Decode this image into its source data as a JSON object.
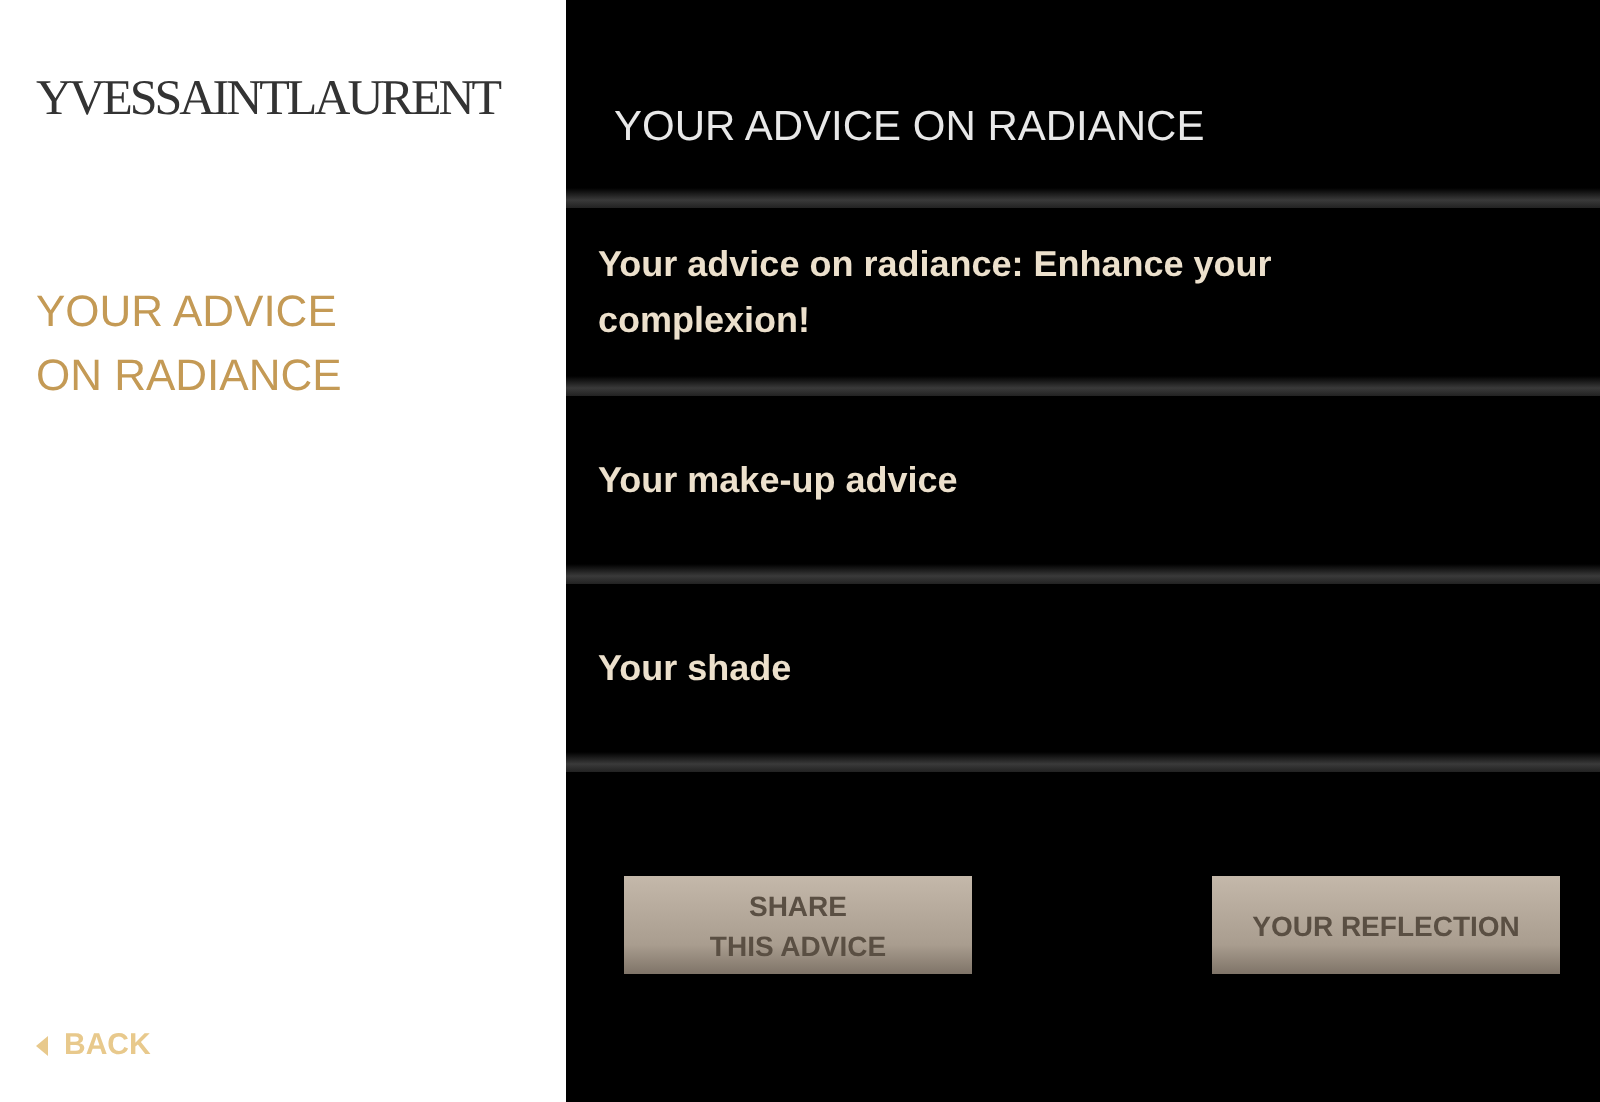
{
  "logo": "YVESSAINTLAURENT",
  "sidebar": {
    "title_lines": [
      "YOUR ADVICE",
      "ON RADIANCE"
    ],
    "back": "BACK"
  },
  "header": "YOUR ADVICE ON RADIANCE",
  "items": [
    {
      "label": "Your advice on radiance: Enhance your complexion!"
    },
    {
      "label": "Your make-up advice"
    },
    {
      "label": "Your shade"
    }
  ],
  "buttons": [
    {
      "lines": [
        "SHARE",
        "THIS ADVICE"
      ]
    },
    {
      "lines": [
        "YOUR REFLECTION"
      ]
    }
  ]
}
